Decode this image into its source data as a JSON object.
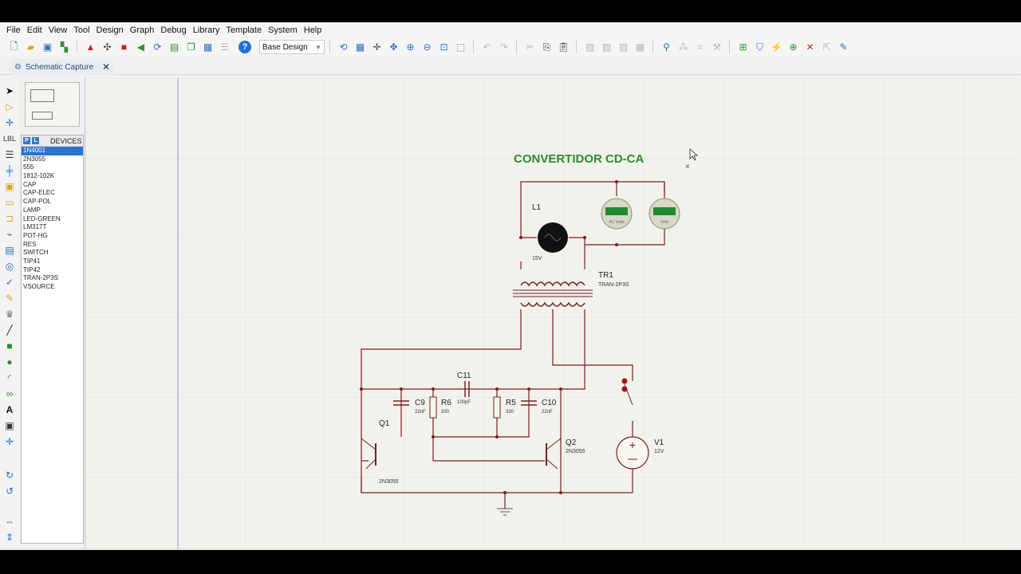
{
  "menu": [
    "File",
    "Edit",
    "View",
    "Tool",
    "Design",
    "Graph",
    "Debug",
    "Library",
    "Template",
    "System",
    "Help"
  ],
  "toolbar": {
    "variant_label": "Base Design",
    "icons_left": [
      "new-icon",
      "open-icon",
      "save-icon",
      "import-icon",
      "pick-icon",
      "component-icon",
      "stop-icon",
      "back-icon",
      "refresh-icon",
      "green-box-icon",
      "copy-doc-icon",
      "grid-icon",
      "list-icon"
    ],
    "icons_right": [
      "redraw-icon",
      "grid-toggle-icon",
      "origin-icon",
      "pan-icon",
      "zoom-in-icon",
      "zoom-out-icon",
      "zoom-all-icon",
      "zoom-area-icon",
      "undo-icon",
      "redo-icon",
      "cut-icon",
      "copy-icon",
      "paste-icon",
      "block-copy-icon",
      "block-move-icon",
      "block-rotate-icon",
      "block-delete-icon",
      "pick-device-icon",
      "make-device-icon",
      "package-icon",
      "decompose-icon",
      "wire-autorouter-icon",
      "search-tag-icon",
      "property-tool-icon",
      "new-sheet-icon",
      "remove-sheet-icon",
      "exit-to-parent-icon",
      "bom-icon"
    ]
  },
  "tab": {
    "label": "Schematic Capture",
    "close": "✕"
  },
  "devices": {
    "header": "DEVICES",
    "pick_label": "P",
    "lib_label": "L",
    "items": [
      "1N4001",
      "2N3055",
      "555",
      "1812-102K",
      "CAP",
      "CAP-ELEC",
      "CAP-POL",
      "LAMP",
      "LED-GREEN",
      "LM317T",
      "POT-HG",
      "RES",
      "SWITCH",
      "TIP41",
      "TIP42",
      "TRAN-2P3S",
      "VSOURCE"
    ],
    "selected_index": 0
  },
  "schematic": {
    "title": "CONVERTIDOR CD-CA",
    "lamp": {
      "ref": "L1",
      "value": "15V"
    },
    "transformer": {
      "ref": "TR1",
      "value": "TRAN-2P3S"
    },
    "meters": [
      {
        "label": "AC Volts"
      },
      {
        "label": "Volts"
      }
    ],
    "c11": {
      "ref": "C11",
      "value": "100pF"
    },
    "c9": {
      "ref": "C9",
      "value": "22nF"
    },
    "r6": {
      "ref": "R6",
      "value": "330"
    },
    "r5": {
      "ref": "R5",
      "value": "330"
    },
    "c10": {
      "ref": "C10",
      "value": "22nF"
    },
    "q1": {
      "ref": "Q1",
      "value": "2N3055"
    },
    "q2": {
      "ref": "Q2",
      "value": "2N3055"
    },
    "v1": {
      "ref": "V1",
      "value": "12V"
    },
    "wire_color": "#7a1f1f",
    "title_color": "#2e8b2e"
  }
}
